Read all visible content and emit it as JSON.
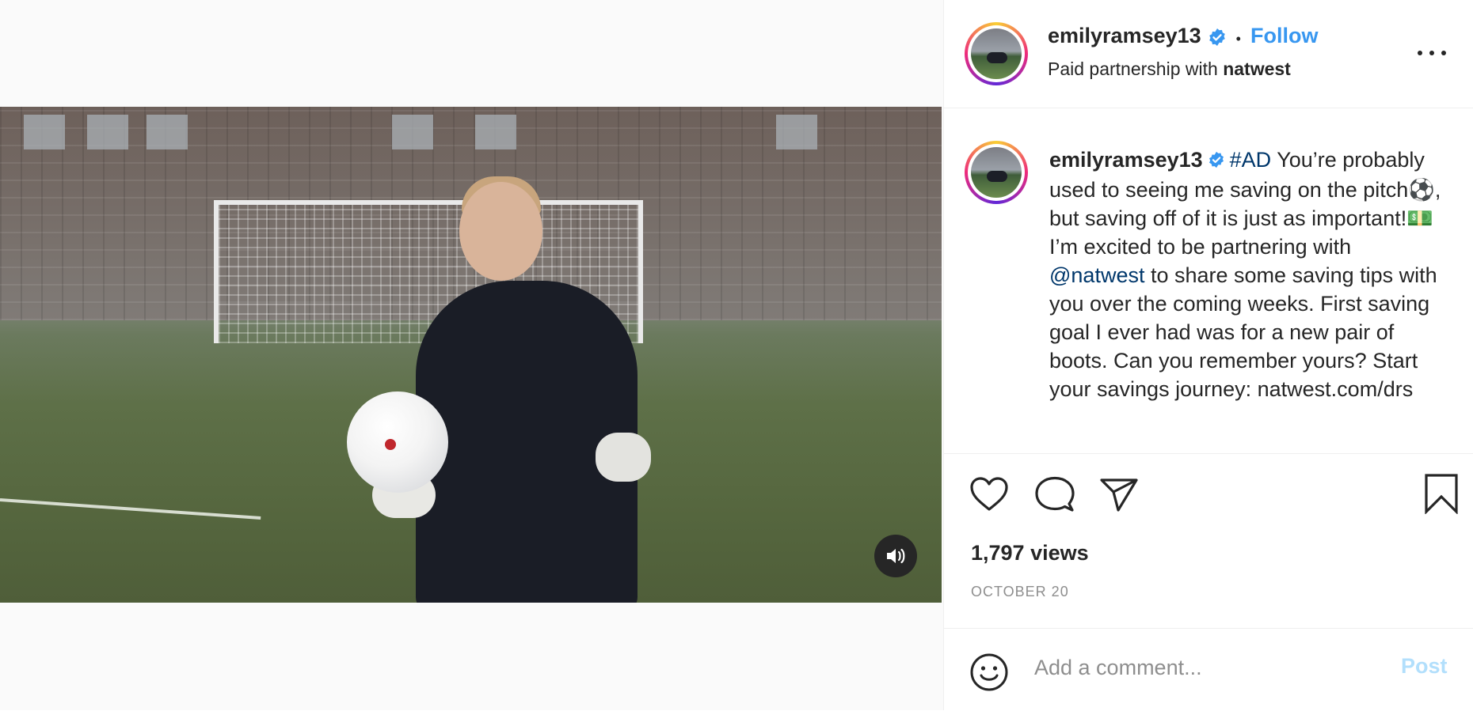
{
  "post": {
    "username": "emilyramsey13",
    "follow_label": "Follow",
    "dot": "•",
    "partnership_prefix": "Paid partnership with",
    "partner": "natwest",
    "caption_username": "emilyramsey13",
    "caption_hashtag": "#AD",
    "caption_part1": "You’re probably used to seeing me saving on the pitch⚽, but saving off of it is just as important!💵 I’m excited to be partnering with",
    "caption_mention": "@natwest",
    "caption_part2": "to share some saving tips with you over the coming weeks. First saving goal I ever had was for a new pair of boots. Can you remember yours? Start your savings journey: natwest.com/drs",
    "views": "1,797 views",
    "date": "OCTOBER 20"
  },
  "comment": {
    "placeholder": "Add a comment...",
    "post_label": "Post"
  },
  "colors": {
    "follow": "#3897f0",
    "link": "#00376b",
    "post_disabled": "#b2dffc",
    "verified": "#3897f0"
  },
  "icons": [
    "sound-on-icon",
    "verified-badge-icon",
    "more-options-icon",
    "heart-icon",
    "comment-icon",
    "share-icon",
    "bookmark-icon",
    "emoji-icon"
  ]
}
